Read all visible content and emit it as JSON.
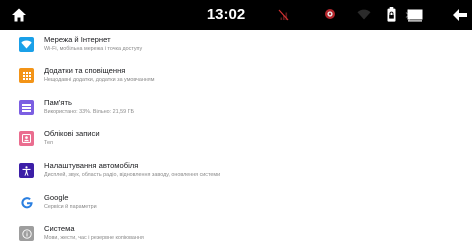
{
  "status_bar": {
    "time": "13:02",
    "icons": [
      "home-icon",
      "no-sim-icon",
      "location-icon",
      "wifi-icon",
      "battery-lock-icon",
      "bluetooth-icon",
      "screen-icon",
      "back-arrow-icon"
    ]
  },
  "colors": {
    "status_bar_bg": "#000000",
    "network": "#1aa0e8",
    "apps": "#f39417",
    "storage": "#7c5fe2",
    "accounts": "#ea6d8f",
    "vehicle": "#3c1ea7",
    "google": "#2a7fe0",
    "system": "#9e9e9e"
  },
  "settings": {
    "items": [
      {
        "title": "Мережа й Інтернет",
        "subtitle": "Wi-Fi, мобільна мережа і точка доступу",
        "icon": "wifi-icon"
      },
      {
        "title": "Додатки та сповіщення",
        "subtitle": "Нещодавні додатки, додатки за умовчанням",
        "icon": "apps-grid-icon"
      },
      {
        "title": "Пам'ять",
        "subtitle": "Використано: 33%. Вільно: 21,59 ГБ",
        "icon": "storage-icon"
      },
      {
        "title": "Облікові записи",
        "subtitle": "Тел",
        "icon": "account-icon"
      },
      {
        "title": "Налаштування автомобіля",
        "subtitle": "Дисплей, звук, область радіо, відновлення заводу, оновлення системи",
        "icon": "accessibility-icon"
      },
      {
        "title": "Google",
        "subtitle": "Сервіси й параметри",
        "icon": "google-icon"
      },
      {
        "title": "Система",
        "subtitle": "Мови, жести, час і резервне копіювання",
        "icon": "info-icon"
      }
    ]
  }
}
